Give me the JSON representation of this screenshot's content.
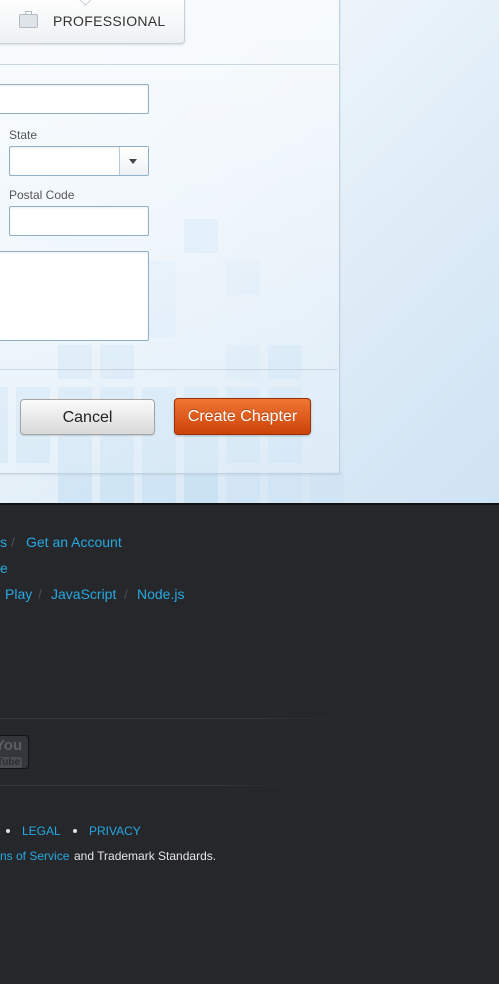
{
  "form": {
    "tab_label": "PROFESSIONAL",
    "state_label": "State",
    "state_value": "",
    "postal_label": "Postal Code",
    "postal_value": "",
    "cancel_label": "Cancel",
    "create_label": "Create Chapter"
  },
  "footer": {
    "row1": [
      "s",
      "Get an Account"
    ],
    "row2": [
      "e"
    ],
    "row3": [
      "Play",
      "JavaScript",
      "Node.js"
    ],
    "social": {
      "yt_top": "You",
      "yt_bottom": "Tube"
    },
    "legal_links": [
      "LEGAL",
      "PRIVACY"
    ],
    "terms_link": "ns of Service",
    "terms_text": "and Trademark Standards."
  }
}
